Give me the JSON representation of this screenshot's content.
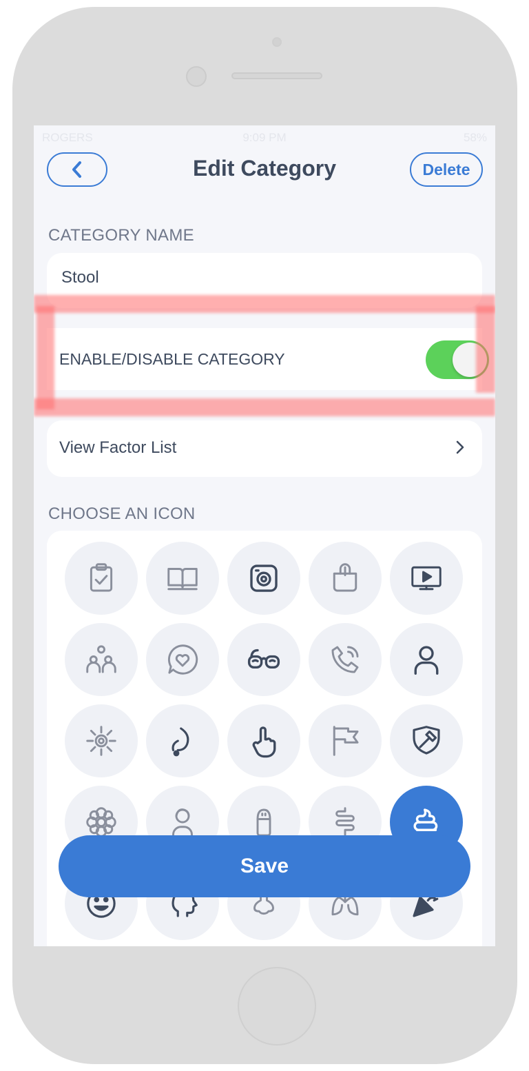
{
  "status_bar": {
    "carrier": "ROGERS",
    "time": "9:09 PM",
    "battery": "58%"
  },
  "header": {
    "title": "Edit Category",
    "delete_label": "Delete"
  },
  "category_name": {
    "section_label": "CATEGORY NAME",
    "value": "Stool"
  },
  "toggle": {
    "label": "ENABLE/DISABLE CATEGORY",
    "enabled": true
  },
  "factor_list": {
    "label": "View Factor List"
  },
  "icons": {
    "section_label": "CHOOSE AN ICON",
    "selected": "poop-icon",
    "items": [
      "clipboard-check-icon",
      "book-open-icon",
      "camera-icon",
      "shopping-bag-icon",
      "tv-play-icon",
      "people-icon",
      "heart-chat-icon",
      "glasses-icon",
      "phone-call-icon",
      "person-icon",
      "sun-icon",
      "stethoscope-icon",
      "hand-pointer-icon",
      "flag-icon",
      "shield-hammer-icon",
      "flower-icon",
      "woman-icon",
      "salt-shaker-icon",
      "intestine-icon",
      "poop-icon",
      "smile-heart-eyes-icon",
      "head-profile-icon",
      "nose-icon",
      "lungs-icon",
      "party-popper-icon"
    ]
  },
  "save": {
    "label": "Save"
  },
  "colors": {
    "accent": "#3a7bd5",
    "toggle_on": "#5cd15a",
    "highlight": "#ff6e6e"
  }
}
